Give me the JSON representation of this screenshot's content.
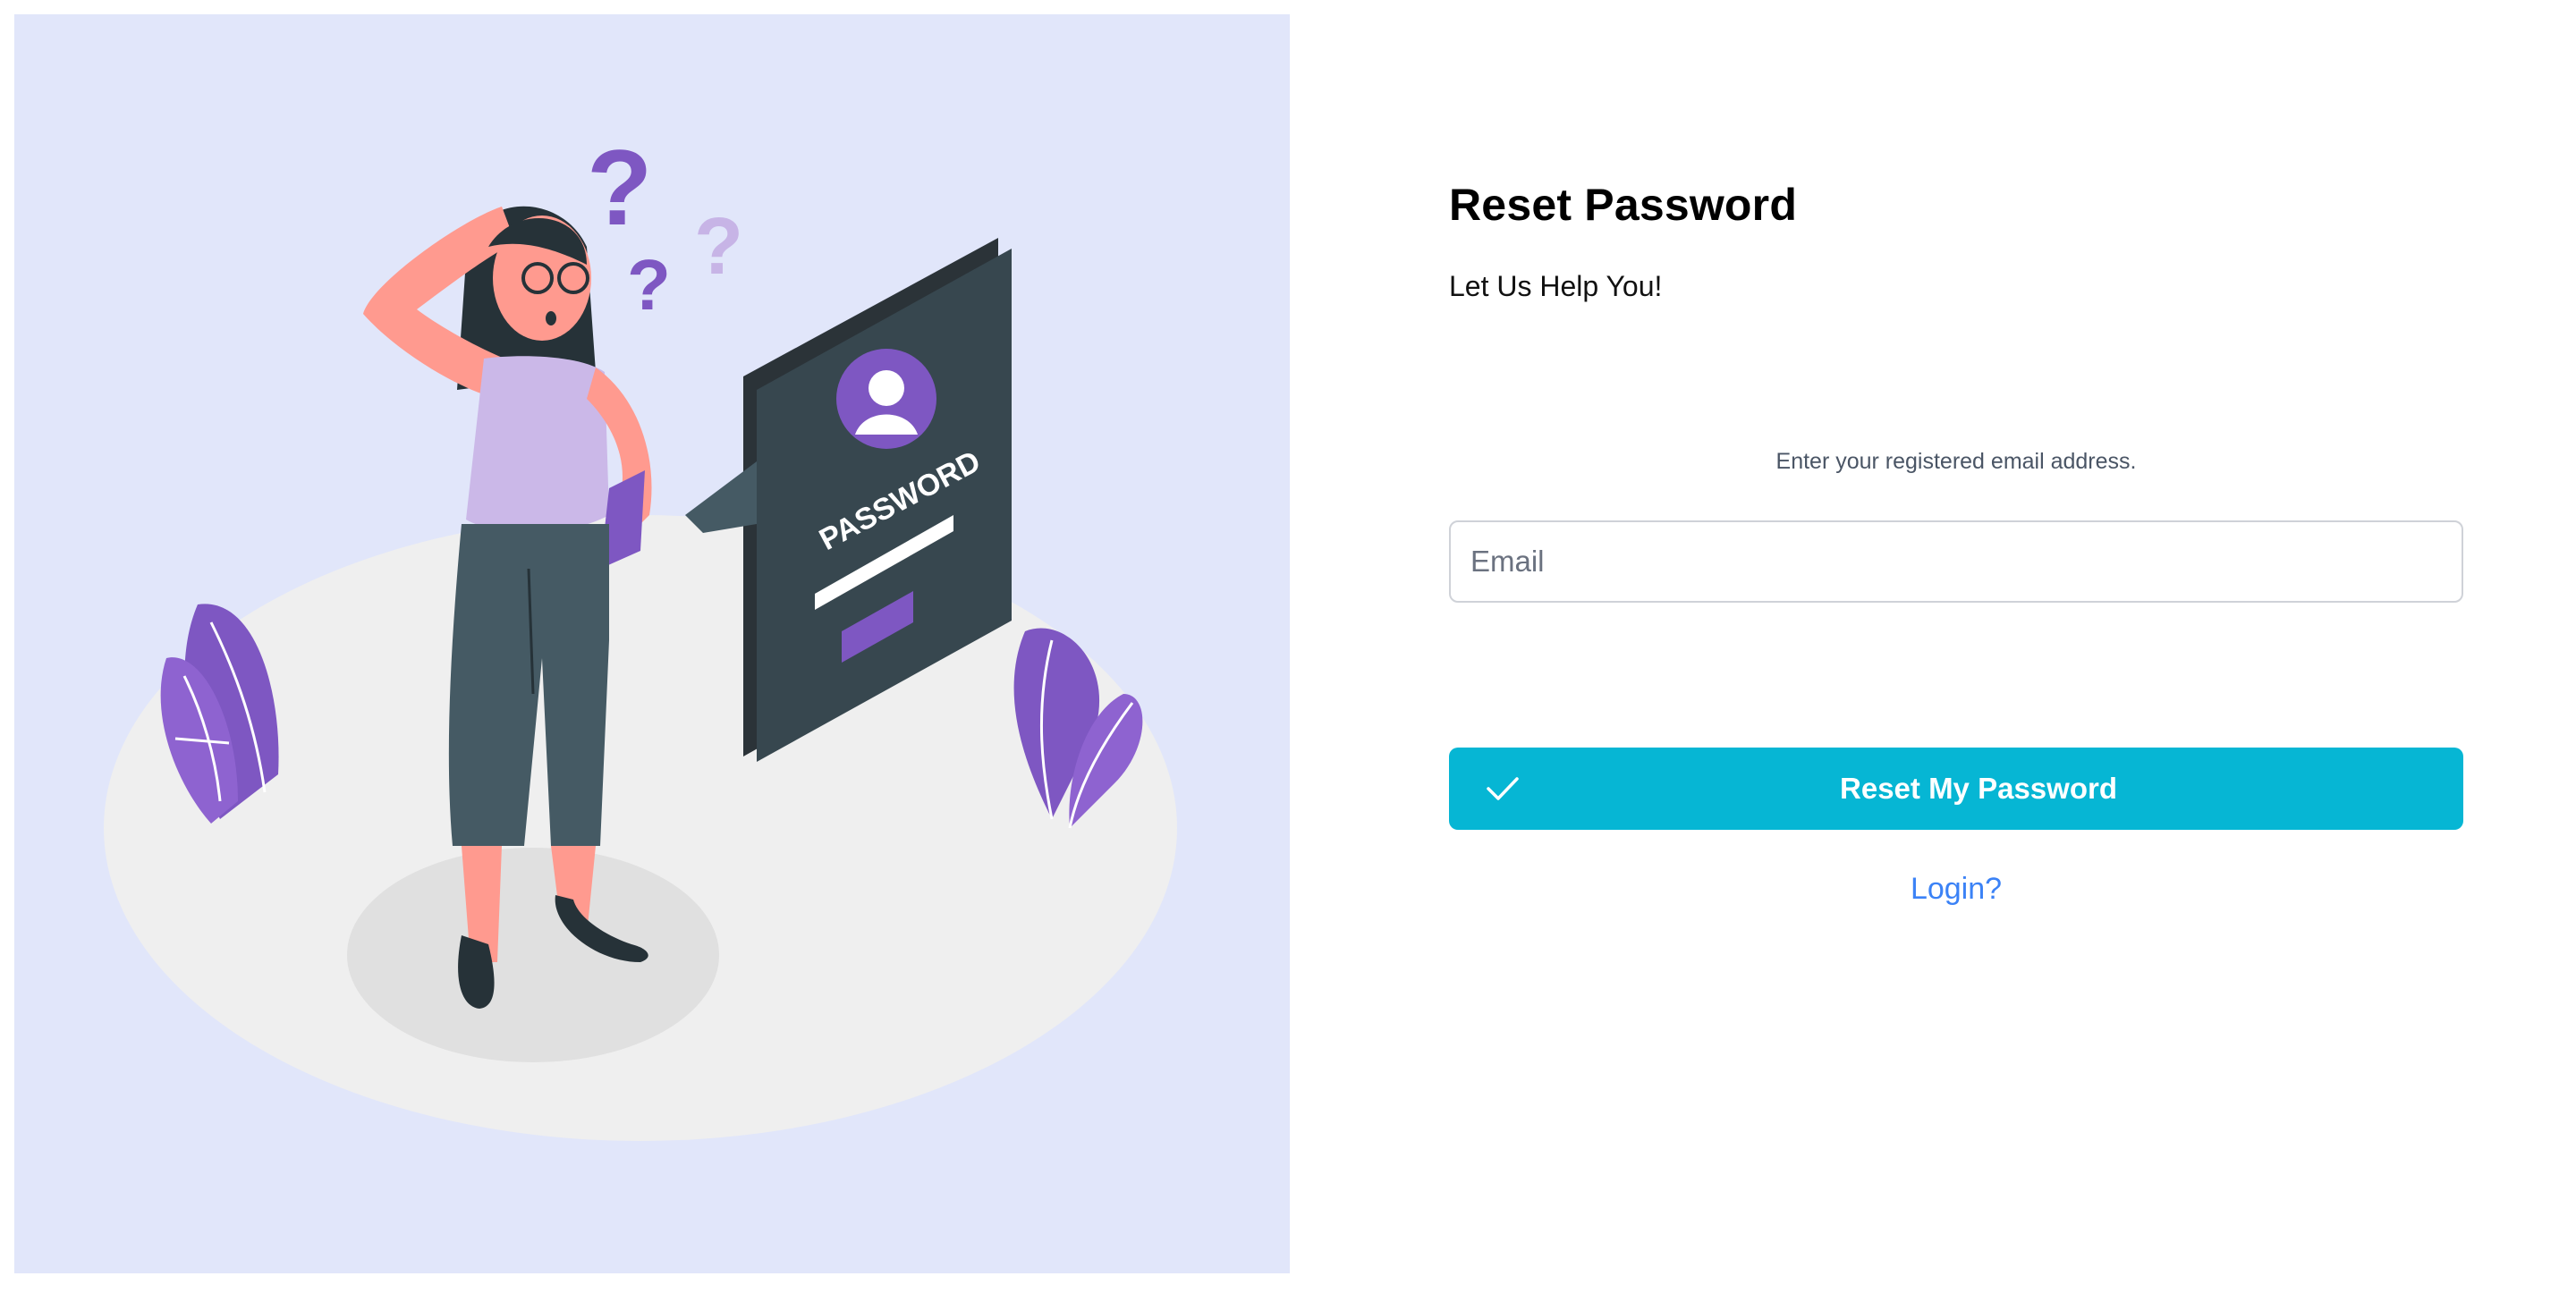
{
  "illustration": {
    "icon": "confused-person-password-illustration",
    "panel_text": "PASSWORD",
    "colors": {
      "background": "#e1e6fa",
      "accent_purple": "#7e57c2"
    }
  },
  "form": {
    "title": "Reset Password",
    "subtitle": "Let Us Help You!",
    "instruction": "Enter your registered email address.",
    "email_placeholder": "Email",
    "email_value": "",
    "submit_label": "Reset My Password",
    "submit_icon": "check-icon",
    "login_link": "Login?"
  },
  "colors": {
    "button": "#06b6d4",
    "link": "#3b82f6"
  }
}
